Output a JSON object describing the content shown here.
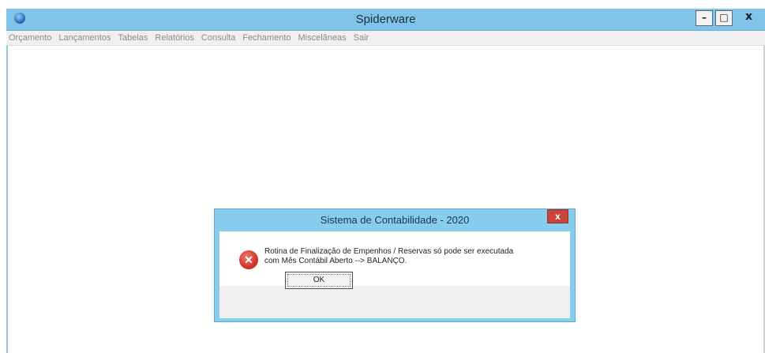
{
  "window": {
    "title": "Spiderware",
    "controls": {
      "minimize": "–",
      "maximize": "□",
      "close": "x"
    }
  },
  "menu": {
    "items": [
      "Orçamento",
      "Lançamentos",
      "Tabelas",
      "Relatórios",
      "Consulta",
      "Fechamento",
      "Miscelâneas",
      "Sair"
    ]
  },
  "dialog": {
    "title": "Sistema de Contabilidade - 2020",
    "close_label": "x",
    "icon": "error-icon",
    "message_line1": "Rotina de Finalização de Empenhos / Reservas só pode ser executada",
    "message_line2": "com Mês Contábil Aberto --> BALANÇO.",
    "ok_label": "OK"
  }
}
